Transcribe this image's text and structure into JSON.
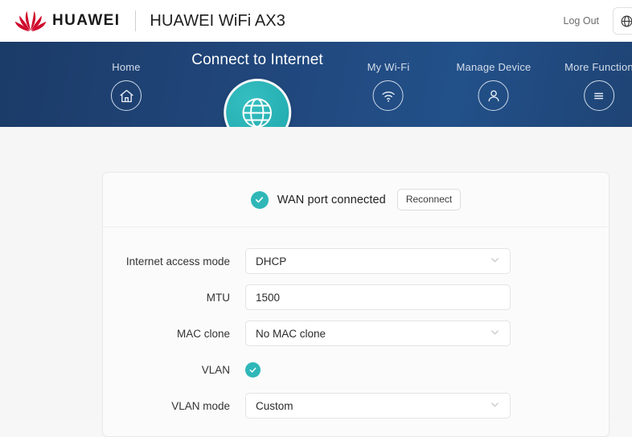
{
  "header": {
    "brand_word": "HUAWEI",
    "model_title": "HUAWEI WiFi AX3",
    "logout_label": "Log Out",
    "logo_icon": "huawei-flower-logo",
    "language_icon": "globe-icon",
    "brand_color": "#cf0a2c"
  },
  "nav": {
    "accent_color": "#2fb7b8",
    "bar_color": "#21477c",
    "items": [
      {
        "label": "Home",
        "icon": "home-icon",
        "active": false
      },
      {
        "label": "Connect to Internet",
        "icon": "globe-icon",
        "active": true
      },
      {
        "label": "My Wi-Fi",
        "icon": "wifi-icon",
        "active": false
      },
      {
        "label": "Manage Device",
        "icon": "user-icon",
        "active": false
      },
      {
        "label": "More Function",
        "icon": "hamburger-icon",
        "active": false
      }
    ]
  },
  "card": {
    "status_text": "WAN port connected",
    "status_icon": "check-circle-icon",
    "status_color": "#2fb7b8",
    "reconnect_label": "Reconnect",
    "fields": [
      {
        "label": "Internet access mode",
        "value": "DHCP",
        "type": "select"
      },
      {
        "label": "MTU",
        "value": "1500",
        "type": "text"
      },
      {
        "label": "MAC clone",
        "value": "No MAC clone",
        "type": "select"
      },
      {
        "label": "VLAN",
        "value": "",
        "type": "checkbox",
        "checked": true
      },
      {
        "label": "VLAN mode",
        "value": "Custom",
        "type": "select"
      }
    ]
  }
}
